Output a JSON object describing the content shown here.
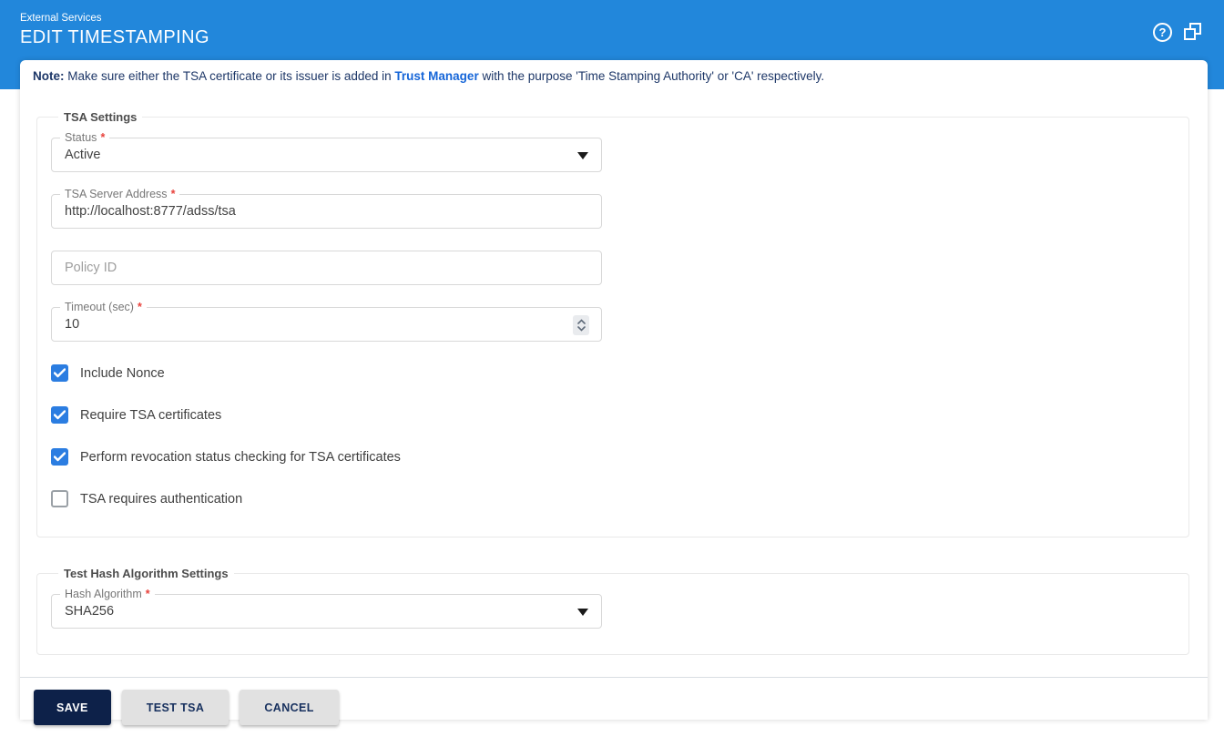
{
  "header": {
    "breadcrumb": "External Services",
    "title": "EDIT TIMESTAMPING",
    "help_glyph": "?"
  },
  "note": {
    "prefix": "Note:",
    "before_link": " Make sure either the TSA certificate or its issuer is added in ",
    "link": "Trust Manager",
    "after_link": " with the purpose 'Time Stamping Authority' or 'CA' respectively."
  },
  "required_marker": "*",
  "tsa_settings": {
    "legend": "TSA Settings",
    "status": {
      "label": "Status",
      "required": true,
      "value": "Active"
    },
    "server_address": {
      "label": "TSA Server Address",
      "required": true,
      "value": "http://localhost:8777/adss/tsa"
    },
    "policy_id": {
      "placeholder": "Policy ID",
      "value": ""
    },
    "timeout": {
      "label": "Timeout (sec)",
      "required": true,
      "value": "10"
    },
    "checkboxes": [
      {
        "label": "Include Nonce",
        "checked": true
      },
      {
        "label": "Require TSA certificates",
        "checked": true
      },
      {
        "label": "Perform revocation status checking for TSA certificates",
        "checked": true
      },
      {
        "label": "TSA requires authentication",
        "checked": false
      }
    ]
  },
  "hash_settings": {
    "legend": "Test Hash Algorithm Settings",
    "hash_algorithm": {
      "label": "Hash Algorithm",
      "required": true,
      "value": "SHA256"
    }
  },
  "actions": {
    "save": "SAVE",
    "test_tsa": "TEST TSA",
    "cancel": "CANCEL"
  },
  "colors": {
    "header_blue": "#2287db",
    "note_text": "#1c3667",
    "link_blue": "#1565d8",
    "checkbox_blue": "#2b7de1",
    "save_button_bg": "#0d2149",
    "secondary_button_bg": "#e1e1e1",
    "required_red": "#e8423c"
  }
}
